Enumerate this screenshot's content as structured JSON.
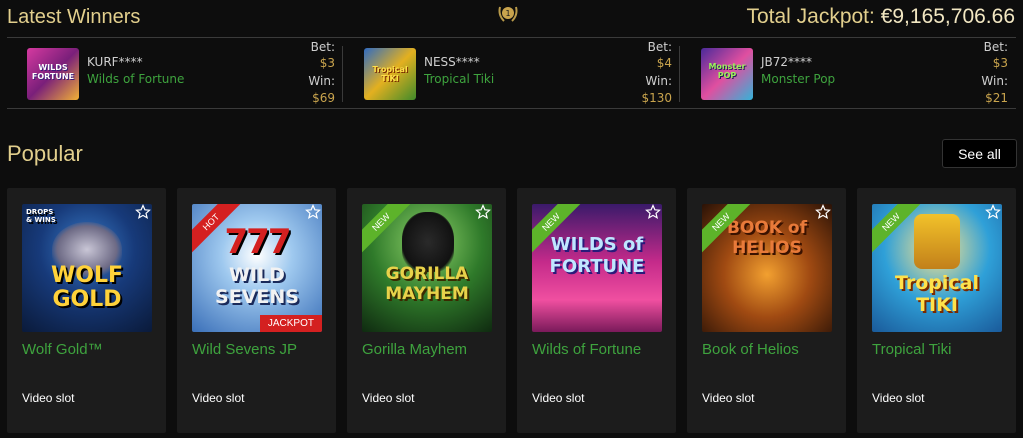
{
  "header": {
    "title": "Latest Winners",
    "badge_number": "1",
    "jackpot_label": "Total Jackpot:",
    "jackpot_amount": "€9,165,706.66"
  },
  "winners": [
    {
      "name": "KURF****",
      "game": "Wilds of Fortune",
      "bet_label": "Bet:",
      "bet": "$3",
      "win_label": "Win:",
      "win": "$69",
      "thumb_text": "WILDS FORTUNE"
    },
    {
      "name": "NESS****",
      "game": "Tropical Tiki",
      "bet_label": "Bet:",
      "bet": "$4",
      "win_label": "Win:",
      "win": "$130",
      "thumb_text": "Tropical TIKI"
    },
    {
      "name": "JB72****",
      "game": "Monster Pop",
      "bet_label": "Bet:",
      "bet": "$3",
      "win_label": "Win:",
      "win": "$21",
      "thumb_text": "Monster POP"
    }
  ],
  "popular": {
    "title": "Popular",
    "see_all": "See all",
    "games": [
      {
        "name": "Wolf Gold™",
        "type": "Video slot",
        "logo": "WOLF GOLD",
        "badge": "DROPS & WINS",
        "ribbon": "",
        "tag": ""
      },
      {
        "name": "Wild Sevens JP",
        "type": "Video slot",
        "logo": "WILD SEVENS",
        "badge": "777",
        "ribbon": "HOT",
        "tag": "JACKPOT"
      },
      {
        "name": "Gorilla Mayhem",
        "type": "Video slot",
        "logo": "GORILLA MAYHEM",
        "badge": "",
        "ribbon": "NEW",
        "tag": ""
      },
      {
        "name": "Wilds of Fortune",
        "type": "Video slot",
        "logo": "WILDS of FORTUNE",
        "badge": "",
        "ribbon": "NEW",
        "tag": ""
      },
      {
        "name": "Book of Helios",
        "type": "Video slot",
        "logo": "BOOK of HELIOS",
        "badge": "",
        "ribbon": "NEW",
        "tag": ""
      },
      {
        "name": "Tropical Tiki",
        "type": "Video slot",
        "logo": "Tropical TIKI",
        "badge": "",
        "ribbon": "NEW",
        "tag": ""
      }
    ]
  },
  "colors": {
    "gold": "#e2cf8d",
    "green": "#3ea33e",
    "new_ribbon": "#5db32a",
    "hot_ribbon": "#d42020"
  }
}
